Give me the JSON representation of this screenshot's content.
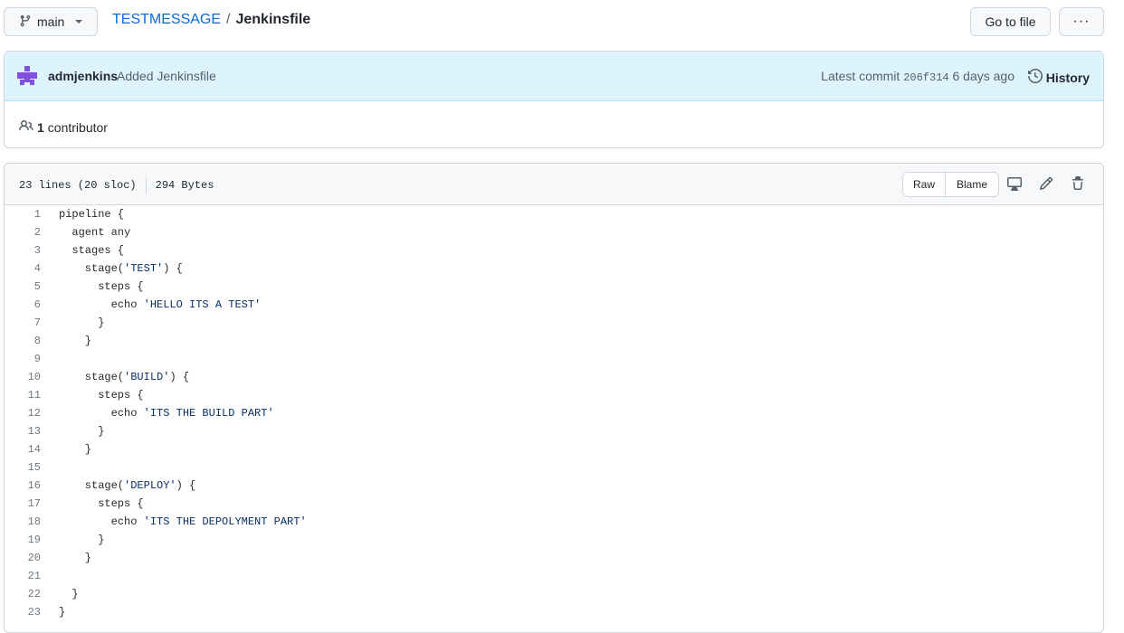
{
  "toolbar": {
    "branch": "main",
    "go_to_file": "Go to file",
    "more": "···"
  },
  "breadcrumb": {
    "repo": "TESTMESSAGE",
    "separator": "/",
    "file": "Jenkinsfile"
  },
  "commit": {
    "author": "admjenkins",
    "message": "Added Jenkinsfile",
    "latest_label": "Latest commit",
    "sha": "206f314",
    "time": "6 days ago",
    "history_label": "History"
  },
  "contributors": {
    "count": "1",
    "label": "contributor"
  },
  "file": {
    "lines_info": "23 lines (20 sloc)",
    "size": "294 Bytes",
    "raw_label": "Raw",
    "blame_label": "Blame"
  },
  "code": [
    {
      "n": "1",
      "text": "pipeline {"
    },
    {
      "n": "2",
      "text": "  agent any"
    },
    {
      "n": "3",
      "text": "  stages {"
    },
    {
      "n": "4",
      "text": "    stage('TEST') {"
    },
    {
      "n": "5",
      "text": "      steps {"
    },
    {
      "n": "6",
      "text": "        echo 'HELLO ITS A TEST'"
    },
    {
      "n": "7",
      "text": "      }"
    },
    {
      "n": "8",
      "text": "    }"
    },
    {
      "n": "9",
      "text": ""
    },
    {
      "n": "10",
      "text": "    stage('BUILD') {"
    },
    {
      "n": "11",
      "text": "      steps {"
    },
    {
      "n": "12",
      "text": "        echo 'ITS THE BUILD PART'"
    },
    {
      "n": "13",
      "text": "      }"
    },
    {
      "n": "14",
      "text": "    }"
    },
    {
      "n": "15",
      "text": ""
    },
    {
      "n": "16",
      "text": "    stage('DEPLOY') {"
    },
    {
      "n": "17",
      "text": "      steps {"
    },
    {
      "n": "18",
      "text": "        echo 'ITS THE DEPOLYMENT PART'"
    },
    {
      "n": "19",
      "text": "      }"
    },
    {
      "n": "20",
      "text": "    }"
    },
    {
      "n": "21",
      "text": ""
    },
    {
      "n": "22",
      "text": "  }"
    },
    {
      "n": "23",
      "text": "}"
    }
  ],
  "icons": {
    "branch": "git-branch-icon",
    "avatar": "avatar",
    "history": "history-icon",
    "people": "people-icon",
    "display": "display-icon",
    "edit": "pencil-icon",
    "delete": "trash-icon"
  },
  "colors": {
    "link": "#0969da",
    "commit_bar": "#ddf4ff",
    "avatar": "#8250df",
    "string": "#0a3069"
  }
}
